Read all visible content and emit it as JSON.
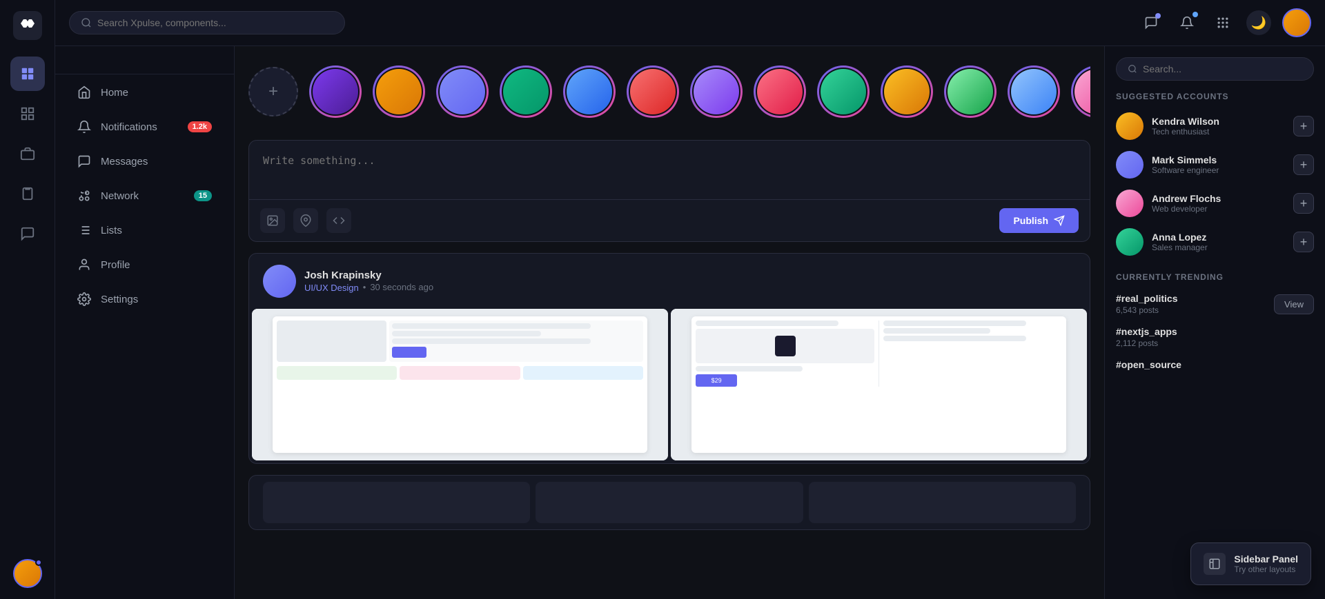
{
  "app": {
    "name": "Xpulse"
  },
  "topbar": {
    "search_placeholder": "Search Xpulse, components...",
    "theme_icon": "🌙"
  },
  "icon_sidebar": {
    "items": [
      {
        "name": "dashboard",
        "label": "Dashboard"
      },
      {
        "name": "grid",
        "label": "Grid"
      },
      {
        "name": "briefcase",
        "label": "Briefcase"
      },
      {
        "name": "clipboard",
        "label": "Clipboard"
      },
      {
        "name": "message",
        "label": "Message"
      }
    ]
  },
  "nav_sidebar": {
    "items": [
      {
        "id": "home",
        "label": "Home"
      },
      {
        "id": "notifications",
        "label": "Notifications",
        "badge": "1.2k",
        "badge_type": "red"
      },
      {
        "id": "messages",
        "label": "Messages"
      },
      {
        "id": "network",
        "label": "Network",
        "badge": "15",
        "badge_type": "teal"
      },
      {
        "id": "lists",
        "label": "Lists"
      },
      {
        "id": "profile",
        "label": "Profile"
      },
      {
        "id": "settings",
        "label": "Settings"
      }
    ]
  },
  "stories": {
    "add_label": "+",
    "avatars": [
      {
        "id": 1,
        "color_class": "av1"
      },
      {
        "id": 2,
        "color_class": "av2"
      },
      {
        "id": 3,
        "color_class": "av3"
      },
      {
        "id": 4,
        "color_class": "av4"
      },
      {
        "id": 5,
        "color_class": "av5"
      },
      {
        "id": 6,
        "color_class": "av6"
      },
      {
        "id": 7,
        "color_class": "av7"
      },
      {
        "id": 8,
        "color_class": "av8"
      },
      {
        "id": 9,
        "color_class": "av9"
      },
      {
        "id": 10,
        "color_class": "av10"
      },
      {
        "id": 11,
        "color_class": "av11"
      },
      {
        "id": 12,
        "color_class": "av12"
      },
      {
        "id": 13,
        "color_class": "av13"
      }
    ]
  },
  "composer": {
    "placeholder": "Write something...",
    "publish_label": "Publish"
  },
  "posts": [
    {
      "id": 1,
      "author": "Josh Krapinsky",
      "category": "UI/UX Design",
      "time": "30 seconds ago",
      "avatar_color": "av3",
      "has_images": true
    }
  ],
  "right_sidebar": {
    "search_placeholder": "Search...",
    "suggested_title": "SUGGESTED ACCOUNTS",
    "suggested": [
      {
        "name": "Kendra Wilson",
        "sub": "Tech enthusiast",
        "color": "av10"
      },
      {
        "name": "Mark Simmels",
        "sub": "Software engineer",
        "color": "av3"
      },
      {
        "name": "Andrew Flochs",
        "sub": "Web developer",
        "color": "av13"
      },
      {
        "name": "Anna Lopez",
        "sub": "Sales manager",
        "color": "av9"
      }
    ],
    "trending_title": "CURRENTLY TRENDING",
    "trending": [
      {
        "tag": "#real_politics",
        "count": "6,543 posts",
        "has_view": true
      },
      {
        "tag": "#nextjs_apps",
        "count": "2,112 posts",
        "has_view": false
      },
      {
        "tag": "#open_source",
        "count": "",
        "has_view": false
      }
    ],
    "view_label": "View"
  },
  "sidebar_panel": {
    "title": "Sidebar Panel",
    "subtitle": "Try other layouts"
  }
}
